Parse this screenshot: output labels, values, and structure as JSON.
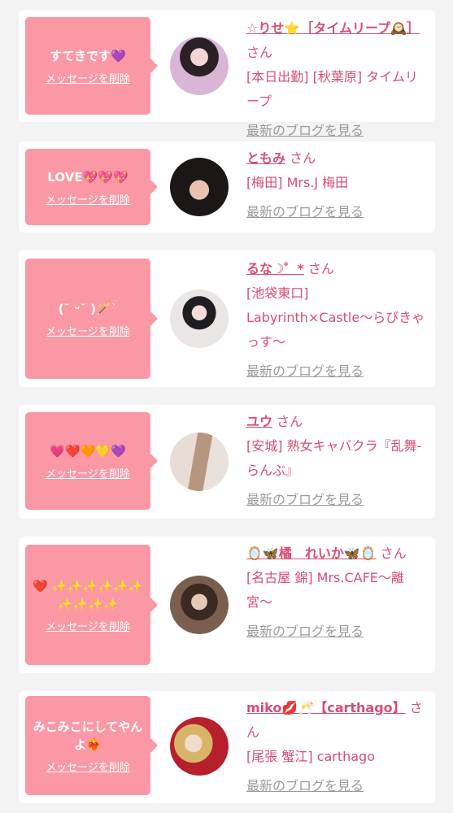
{
  "colors": {
    "bubble": "#fa98a6",
    "accent": "#d94d73",
    "muted": "#9a9a9a",
    "background": "#f3f3f3",
    "card": "#ffffff"
  },
  "delete_label": "メッセージを削除",
  "blog_label": "最新のブログを見る",
  "san": "さん",
  "entries": [
    {
      "message": "すてきです💜",
      "name": "☆りせ⭐［タイムリープ🕰️］",
      "shop": "[本日出勤] [秋葉原] タイムリープ"
    },
    {
      "message": "LOVE💖💖💖",
      "name": "ともみ",
      "shop": "[梅田] Mrs.J 梅田"
    },
    {
      "message": "(˘ ᵕ˘ )🪄`",
      "name": "るな☽゜*",
      "shop": "[池袋東口] Labyrinth×Castle〜らびきゃっす〜"
    },
    {
      "message": "💗❤️🧡💛💜",
      "name": "ユウ",
      "shop": "[安城] 熟女キャバクラ『乱舞-らんぶ』"
    },
    {
      "message": "❤️ ✨✨✨✨✨✨ ✨✨✨✨",
      "name": "🪞🦋橘　れいか🦋🪞",
      "shop": "[名古屋 錦] Mrs.CAFE〜離宮〜"
    },
    {
      "message": "みこみこにしてやんよ❤️‍🔥",
      "name": "miko💋🥂【carthago】",
      "shop": "[尾張 蟹江] carthago"
    }
  ]
}
